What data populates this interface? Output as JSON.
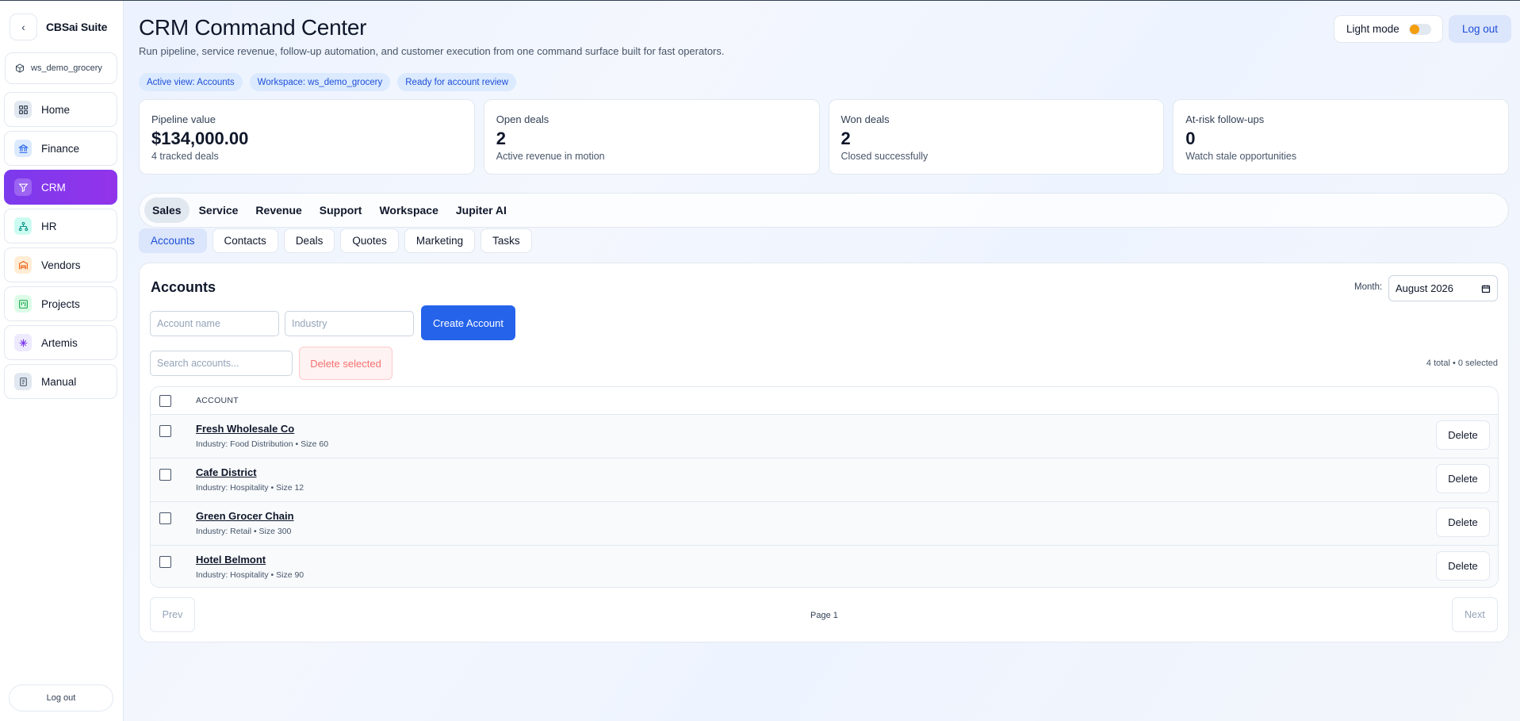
{
  "sidebar": {
    "back_symbol": "‹",
    "brand": "CBSai Suite",
    "workspace": "ws_demo_grocery",
    "items": [
      {
        "label": "Home",
        "icon": "grid-icon"
      },
      {
        "label": "Finance",
        "icon": "bank-icon"
      },
      {
        "label": "CRM",
        "icon": "funnel-icon"
      },
      {
        "label": "HR",
        "icon": "org-chart-icon"
      },
      {
        "label": "Vendors",
        "icon": "warehouse-icon"
      },
      {
        "label": "Projects",
        "icon": "kanban-icon"
      },
      {
        "label": "Artemis",
        "icon": "sparkle-icon"
      },
      {
        "label": "Manual",
        "icon": "book-icon"
      }
    ],
    "active": "CRM",
    "logout": "Log out"
  },
  "header": {
    "title": "CRM Command Center",
    "subtitle": "Run pipeline, service revenue, follow-up automation, and customer execution from one command surface built for fast operators.",
    "chips": [
      "Active view: Accounts",
      "Workspace: ws_demo_grocery",
      "Ready for account review"
    ],
    "mode_label": "Light mode",
    "logout": "Log out"
  },
  "kpis": [
    {
      "label": "Pipeline value",
      "value": "$134,000.00",
      "note": "4 tracked deals"
    },
    {
      "label": "Open deals",
      "value": "2",
      "note": "Active revenue in motion"
    },
    {
      "label": "Won deals",
      "value": "2",
      "note": "Closed successfully"
    },
    {
      "label": "At-risk follow-ups",
      "value": "0",
      "note": "Watch stale opportunities"
    }
  ],
  "primary_tabs": [
    "Sales",
    "Service",
    "Revenue",
    "Support",
    "Workspace",
    "Jupiter AI"
  ],
  "primary_active": "Sales",
  "secondary_tabs": [
    "Accounts",
    "Contacts",
    "Deals",
    "Quotes",
    "Marketing",
    "Tasks"
  ],
  "secondary_active": "Accounts",
  "accounts": {
    "title": "Accounts",
    "month_label": "Month:",
    "month_value": "August 2026",
    "name_placeholder": "Account name",
    "industry_placeholder": "Industry",
    "create_label": "Create Account",
    "search_placeholder": "Search accounts...",
    "delete_selected": "Delete selected",
    "count": "4 total • 0 selected",
    "column_header": "ACCOUNT",
    "rows": [
      {
        "name": "Fresh Wholesale Co",
        "meta": "Industry: Food Distribution • Size 60"
      },
      {
        "name": "Cafe District",
        "meta": "Industry: Hospitality • Size 12"
      },
      {
        "name": "Green Grocer Chain",
        "meta": "Industry: Retail • Size 300"
      },
      {
        "name": "Hotel Belmont",
        "meta": "Industry: Hospitality • Size 90"
      }
    ],
    "row_delete": "Delete",
    "prev": "Prev",
    "page": "Page 1",
    "next": "Next"
  },
  "colors": {
    "accent": "#7c3aed",
    "primary": "#2563eb",
    "toggle": "#f59e0b"
  }
}
